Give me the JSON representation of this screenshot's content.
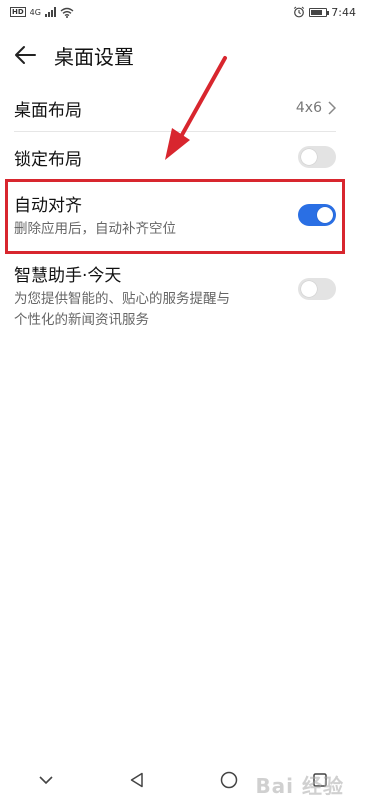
{
  "status_bar": {
    "hd_label": "HD",
    "network_label": "4G",
    "time": "7:44",
    "icons": [
      "hd-icon",
      "signal-icon",
      "wifi-icon",
      "alarm-icon",
      "battery-icon"
    ]
  },
  "header": {
    "back_icon": "arrow-left-icon",
    "title": "桌面设置"
  },
  "settings": [
    {
      "label": "桌面布局",
      "value": "4x6",
      "control": "chevron"
    },
    {
      "label": "锁定布局",
      "control": "toggle",
      "checked": false
    },
    {
      "label": "自动对齐",
      "sublabel": "删除应用后，自动补齐空位",
      "control": "toggle",
      "checked": true
    },
    {
      "label": "智慧助手·今天",
      "sublabel_line1": "为您提供智能的、贴心的服务提醒与",
      "sublabel_line2": "个性化的新闻资讯服务",
      "control": "toggle",
      "checked": false
    }
  ],
  "annotation": {
    "highlight_color": "#d8262e",
    "arrow_color": "#d8262e"
  },
  "nav_bar": {
    "icons": [
      "chevron-down-icon",
      "back-triangle-icon",
      "home-circle-icon",
      "recents-square-icon"
    ]
  },
  "watermark": "Bai 经验",
  "colors": {
    "toggle_on": "#2a6fe4",
    "toggle_off": "#e3e3e3"
  }
}
